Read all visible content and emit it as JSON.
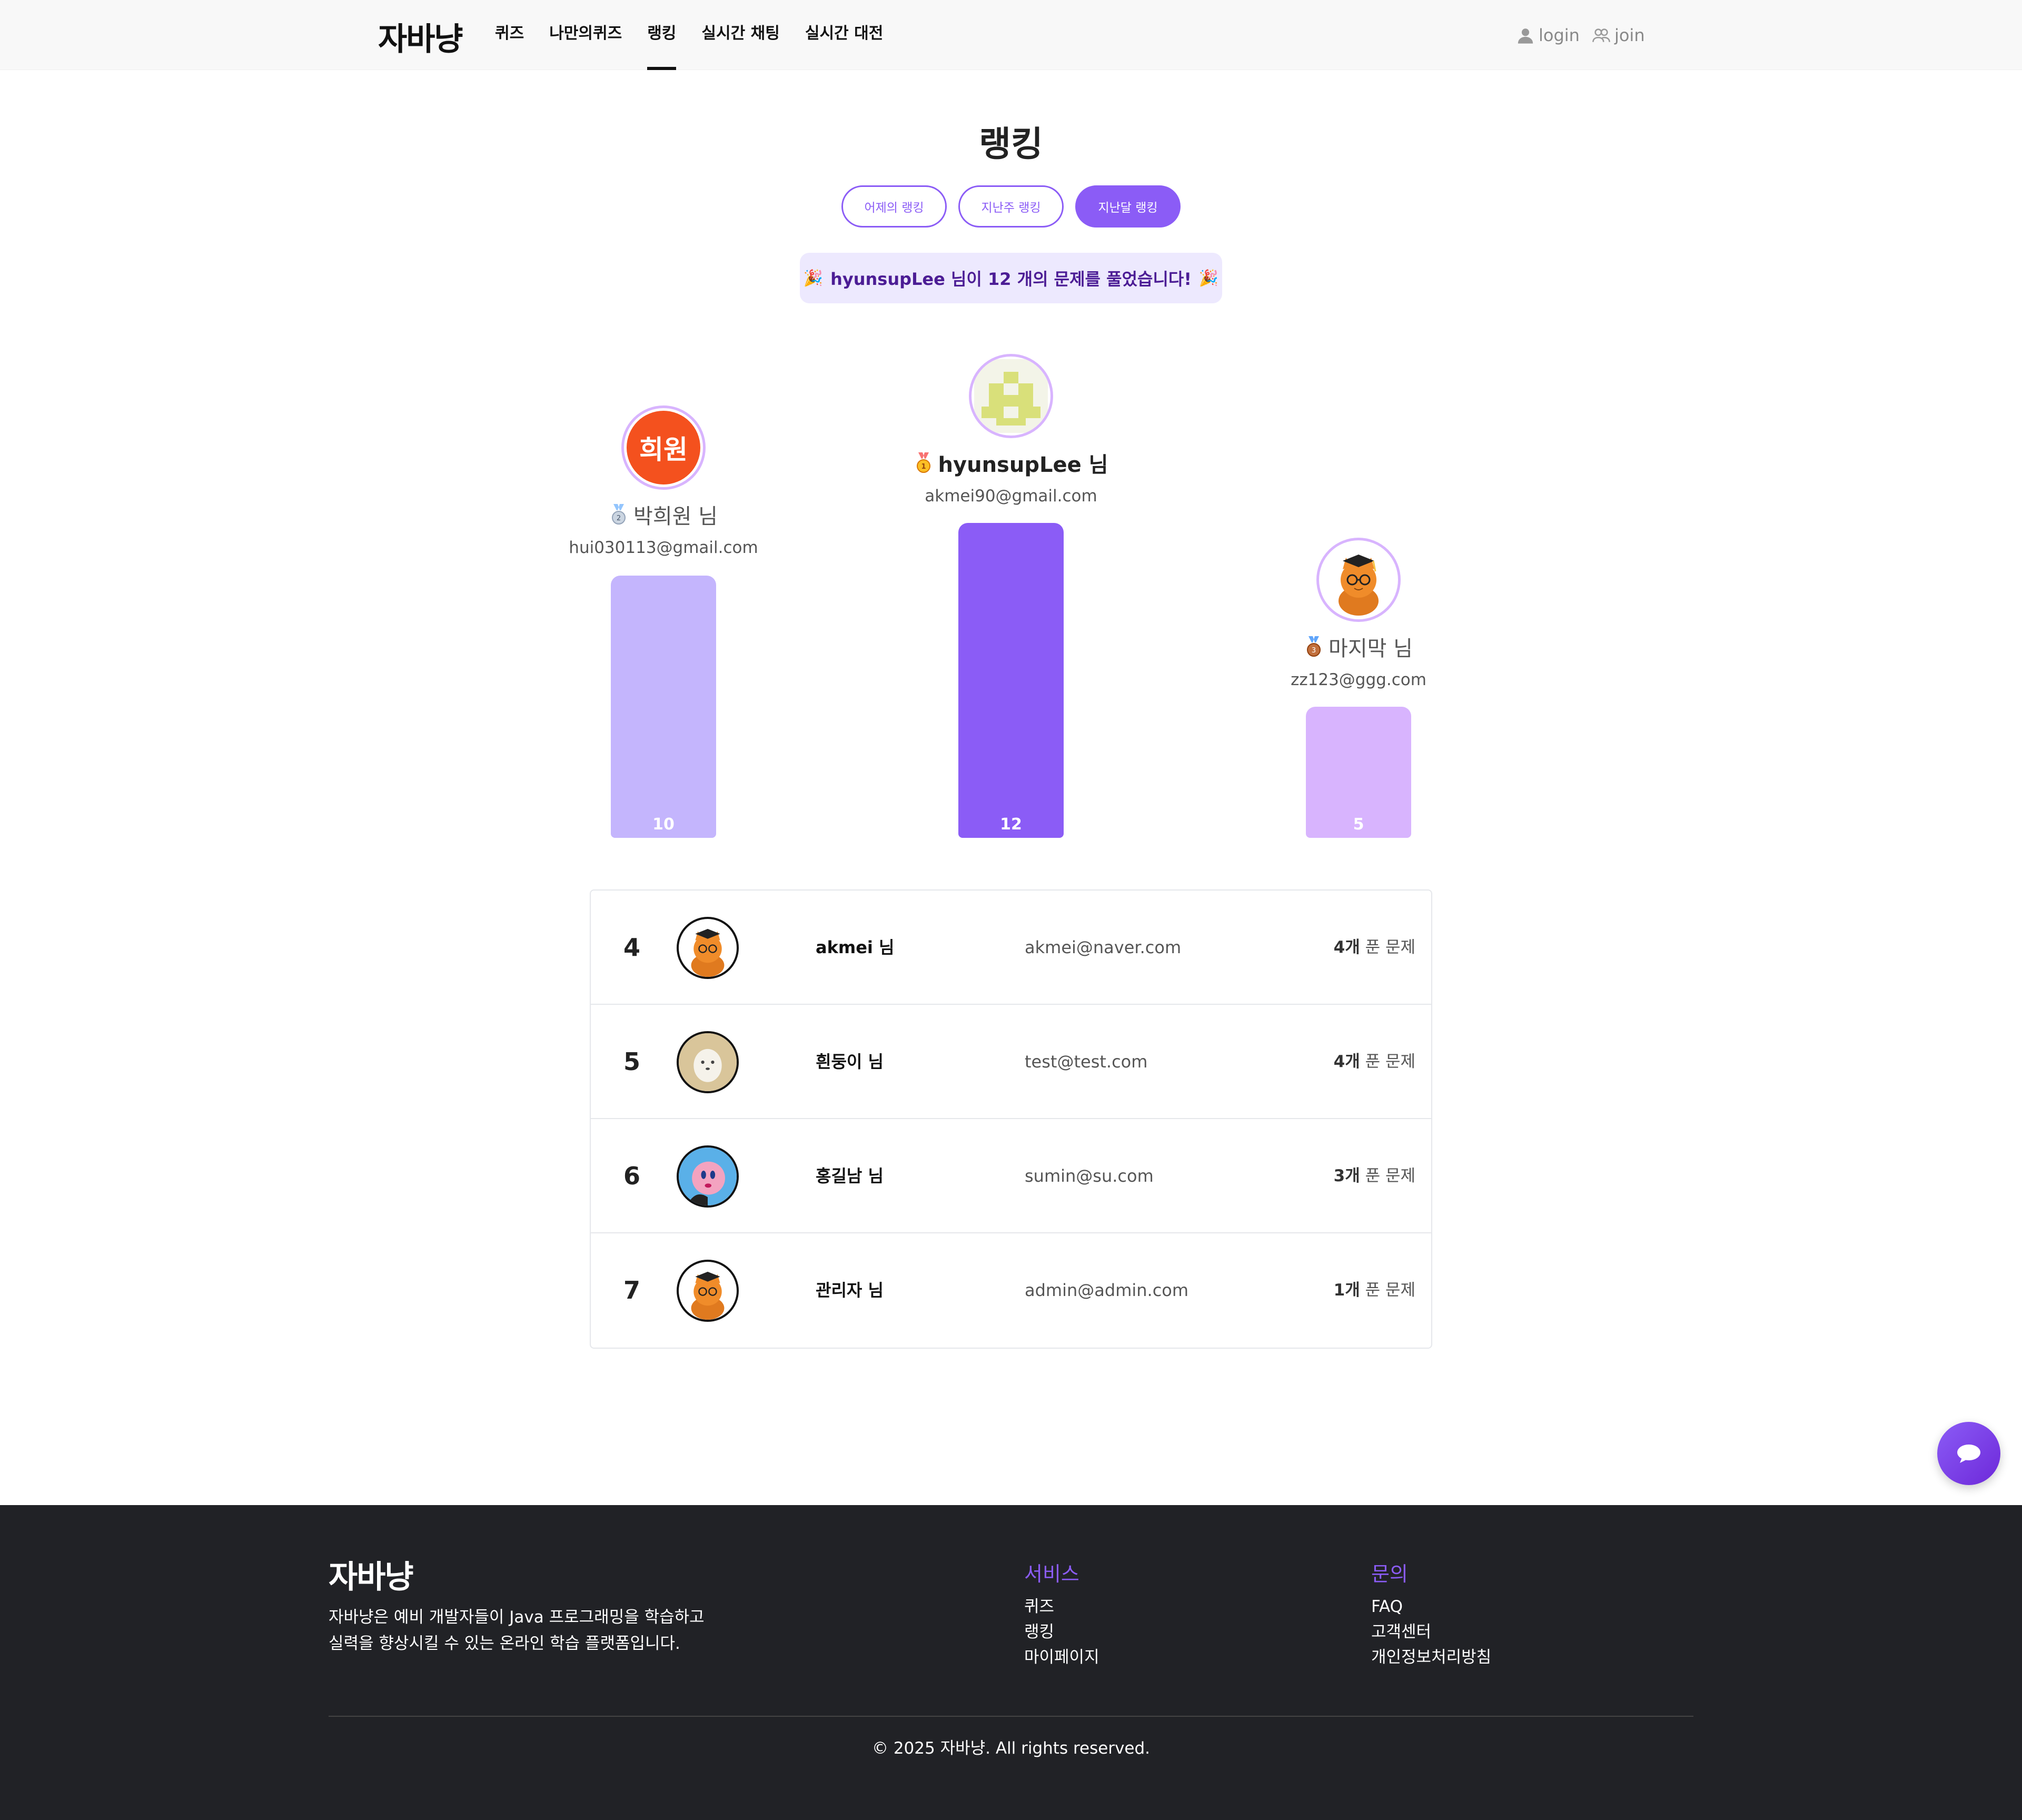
{
  "header": {
    "logo": "자바냥",
    "nav": [
      "퀴즈",
      "나만의퀴즈",
      "랭킹",
      "실시간 채팅",
      "실시간 대전"
    ],
    "active_nav": "랭킹",
    "login": "login",
    "join": "join"
  },
  "title": "랭킹",
  "tabs": [
    "어제의 랭킹",
    "지난주 랭킹",
    "지난달 랭킹"
  ],
  "active_tab": "지난달 랭킹",
  "banner": "hyunsupLee 님이 12 개의 문제를 풀었습니다!",
  "podium": {
    "first": {
      "name": "hyunsupLee 님",
      "email": "akmei90@gmail.com",
      "count": "12",
      "rank": 1,
      "bar_color": "#8b5cf6"
    },
    "second": {
      "name": "박희원 님",
      "email": "hui030113@gmail.com",
      "count": "10",
      "rank": 2,
      "avatar_text": "희원",
      "bar_color": "#c4b5fd"
    },
    "third": {
      "name": "마지막 님",
      "email": "zz123@ggg.com",
      "count": "5",
      "rank": 3,
      "bar_color": "#d8b4fe"
    }
  },
  "rows": [
    {
      "rank": "4",
      "name": "akmei 님",
      "email": "akmei@naver.com",
      "count_num": "4개",
      "count_label": " 푼 문제",
      "avatar": "cat-graduate"
    },
    {
      "rank": "5",
      "name": "흰둥이 님",
      "email": "test@test.com",
      "count_num": "4개",
      "count_label": " 푼 문제",
      "avatar": "white-dog"
    },
    {
      "rank": "6",
      "name": "홍길남 님",
      "email": "sumin@su.com",
      "count_num": "3개",
      "count_label": " 푼 문제",
      "avatar": "pink-character"
    },
    {
      "rank": "7",
      "name": "관리자 님",
      "email": "admin@admin.com",
      "count_num": "1개",
      "count_label": " 푼 문제",
      "avatar": "cat-graduate"
    }
  ],
  "footer": {
    "logo": "자바냥",
    "desc_line1": "자바냥은 예비 개발자들이 Java 프로그래밍을 학습하고",
    "desc_line2": "실력을 향상시킬 수 있는 온라인 학습 플랫폼입니다.",
    "services_title": "서비스",
    "services": [
      "퀴즈",
      "랭킹",
      "마이페이지"
    ],
    "contact_title": "문의",
    "contact": [
      "FAQ",
      "고객센터",
      "개인정보처리방침"
    ],
    "copyright": "© 2025 자바냥. All rights reserved."
  },
  "colors": {
    "accent": "#8b5cf6",
    "footer_bg": "#212226",
    "banner_bg": "#ede9fe"
  }
}
